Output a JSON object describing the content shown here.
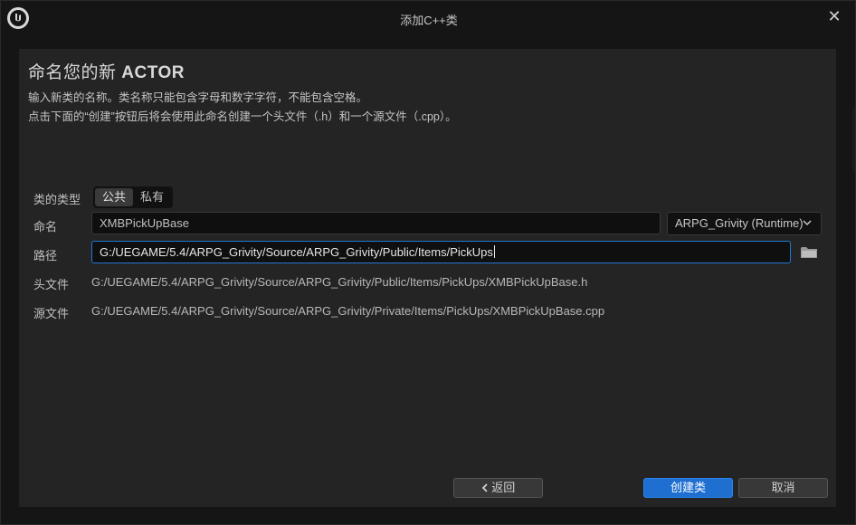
{
  "window": {
    "title": "添加C++类",
    "logo_icon": "unreal-logo-icon",
    "close_icon": "close-icon"
  },
  "header": {
    "title_prefix": "命名您的新",
    "title_class": "ACTOR",
    "desc_line1": "输入新类的名称。类名称只能包含字母和数字字符，不能包含空格。",
    "desc_line2": "点击下面的“创建”按钮后将会使用此命名创建一个头文件（.h）和一个源文件（.cpp）。"
  },
  "form": {
    "class_type_label": "类的类型",
    "class_type_options": [
      "公共",
      "私有"
    ],
    "class_type_selected": "公共",
    "name_label": "命名",
    "name_value": "XMBPickUpBase",
    "module_value": "ARPG_Grivity (Runtime)",
    "path_label": "路径",
    "path_value": "G:/UEGAME/5.4/ARPG_Grivity/Source/ARPG_Grivity/Public/Items/PickUps",
    "header_label": "头文件",
    "header_value": "G:/UEGAME/5.4/ARPG_Grivity/Source/ARPG_Grivity/Public/Items/PickUps/XMBPickUpBase.h",
    "source_label": "源文件",
    "source_value": "G:/UEGAME/5.4/ARPG_Grivity/Source/ARPG_Grivity/Private/Items/PickUps/XMBPickUpBase.cpp"
  },
  "buttons": {
    "back": "返回",
    "create": "创建类",
    "cancel": "取消"
  },
  "colors": {
    "accent": "#1f6fd1",
    "panel": "#242424",
    "background": "#151515"
  }
}
